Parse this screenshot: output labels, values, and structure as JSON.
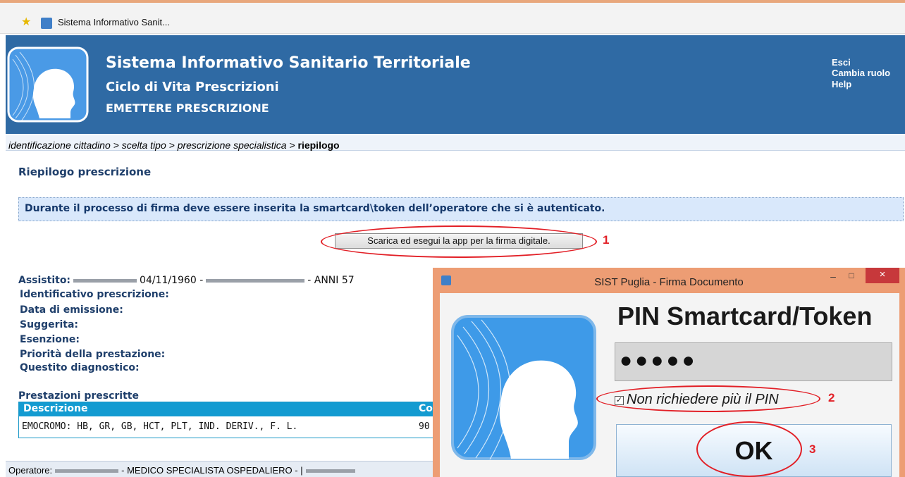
{
  "browser": {
    "tab_title": "Sistema Informativo Sanit..."
  },
  "header": {
    "title": "Sistema Informativo Sanitario Territoriale",
    "subtitle": "Ciclo di Vita Prescrizioni",
    "section": "EMETTERE PRESCRIZIONE",
    "links": [
      "Esci",
      "Cambia ruolo",
      "Help"
    ]
  },
  "breadcrumb": {
    "path": "identificazione cittadino > scelta tipo > prescrizione specialistica > ",
    "current": "riepilogo"
  },
  "page": {
    "title": "Riepilogo prescrizione",
    "notice": "Durante il processo di firma deve essere inserita la smartcard\\token dell’operatore che si è autenticato.",
    "download_button": "Scarica ed esegui la app per la firma digitale.",
    "annotation_1": "1",
    "annotation_2": "2",
    "annotation_3": "3"
  },
  "patient": {
    "label": "Assistito:",
    "birthdate": "04/11/1960 -",
    "age": "- ANNI 57",
    "fields": [
      "Identificativo prescrizione:",
      "Data di emissione:",
      "Suggerita:",
      "Esenzione:",
      "Priorità della prestazione:",
      "Questito diagnostico:"
    ]
  },
  "prestazioni": {
    "title": "Prestazioni prescritte",
    "columns": [
      "Descrizione",
      "Co"
    ],
    "rows": [
      [
        "EMOCROMO: HB, GR, GB, HCT, PLT, IND. DERIV., F. L.",
        "90"
      ]
    ]
  },
  "footer": {
    "operator_label": "Operatore:",
    "role": "- MEDICO SPECIALISTA OSPEDALIERO - |"
  },
  "dialog": {
    "title": "SIST Puglia - Firma Documento",
    "heading": "PIN Smartcard/Token",
    "pin_value": "●●●●●",
    "checkbox_label": "Non richiedere più il PIN",
    "checkbox_checked": true,
    "ok_label": "OK",
    "controls": {
      "minimize": "–",
      "maximize": "□",
      "close": "×"
    }
  },
  "colors": {
    "header_blue": "#2f6aa4",
    "annotation_red": "#e21f26",
    "dialog_frame": "#ed9d74",
    "table_head": "#139bd1"
  }
}
